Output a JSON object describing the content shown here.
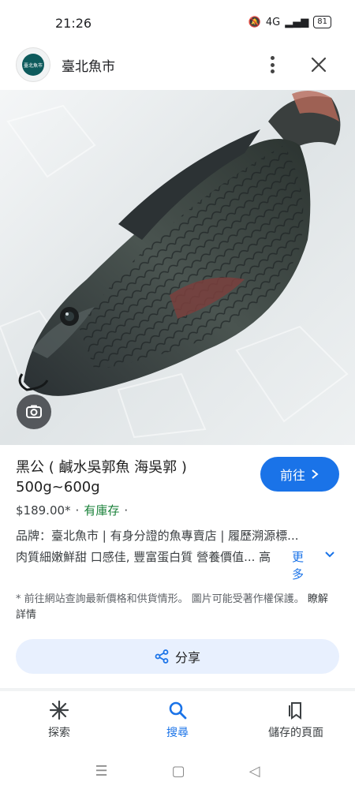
{
  "status": {
    "time": "21:26",
    "signal": "4G",
    "battery": "81"
  },
  "header": {
    "site_name": "臺北魚市",
    "logo_text": "臺北魚市"
  },
  "product": {
    "title": "黑公 ( 鹹水吳郭魚 海吳郭 ) 500g~600g",
    "go_label": "前往",
    "price": "$189.00*",
    "separator": "·",
    "stock": "有庫存",
    "desc_line1": "品牌：臺北魚市 | 有身分證的魚專賣店 | 履歷溯源標...",
    "desc_line2": "肉質細嫩鮮甜 口感佳, 豐富蛋白質 營養價值... 高",
    "more_label": "更多",
    "disclaimer": "* 前往網站查詢最新價格和供貨情形。 圖片可能受著作權保護。",
    "learn_more": "瞭解詳情",
    "share_label": "分享"
  },
  "bottom_nav": [
    {
      "label": "探索",
      "icon": "explore-icon"
    },
    {
      "label": "搜尋",
      "icon": "search-icon"
    },
    {
      "label": "儲存的頁面",
      "icon": "saved-pages-icon"
    }
  ],
  "colors": {
    "accent": "#1a73e8",
    "stock_green": "#188038",
    "share_bg": "#e8f0fe"
  }
}
